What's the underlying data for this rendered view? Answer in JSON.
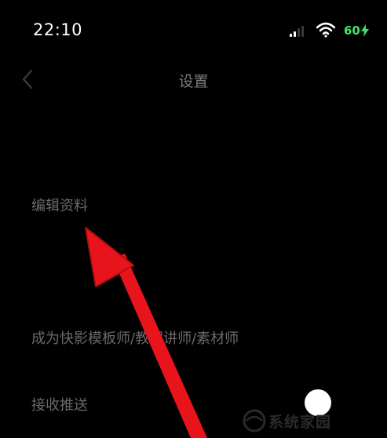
{
  "status_bar": {
    "time": "22:10",
    "battery_level": "60",
    "battery_color": "#3ee06a",
    "icons": [
      "signal-icon",
      "wifi-icon",
      "battery-charging-icon"
    ]
  },
  "nav": {
    "back_icon": "chevron-left-icon",
    "title": "设置"
  },
  "settings": {
    "items": [
      {
        "label": "编辑资料"
      },
      {
        "label": "成为快影模板师/教程讲师/素材师"
      },
      {
        "label": "接收推送",
        "toggle_on": false
      }
    ]
  },
  "watermark": {
    "text": "系统家园"
  },
  "annotation": {
    "type": "arrow",
    "color": "#e8141c",
    "points_to": "编辑资料"
  }
}
